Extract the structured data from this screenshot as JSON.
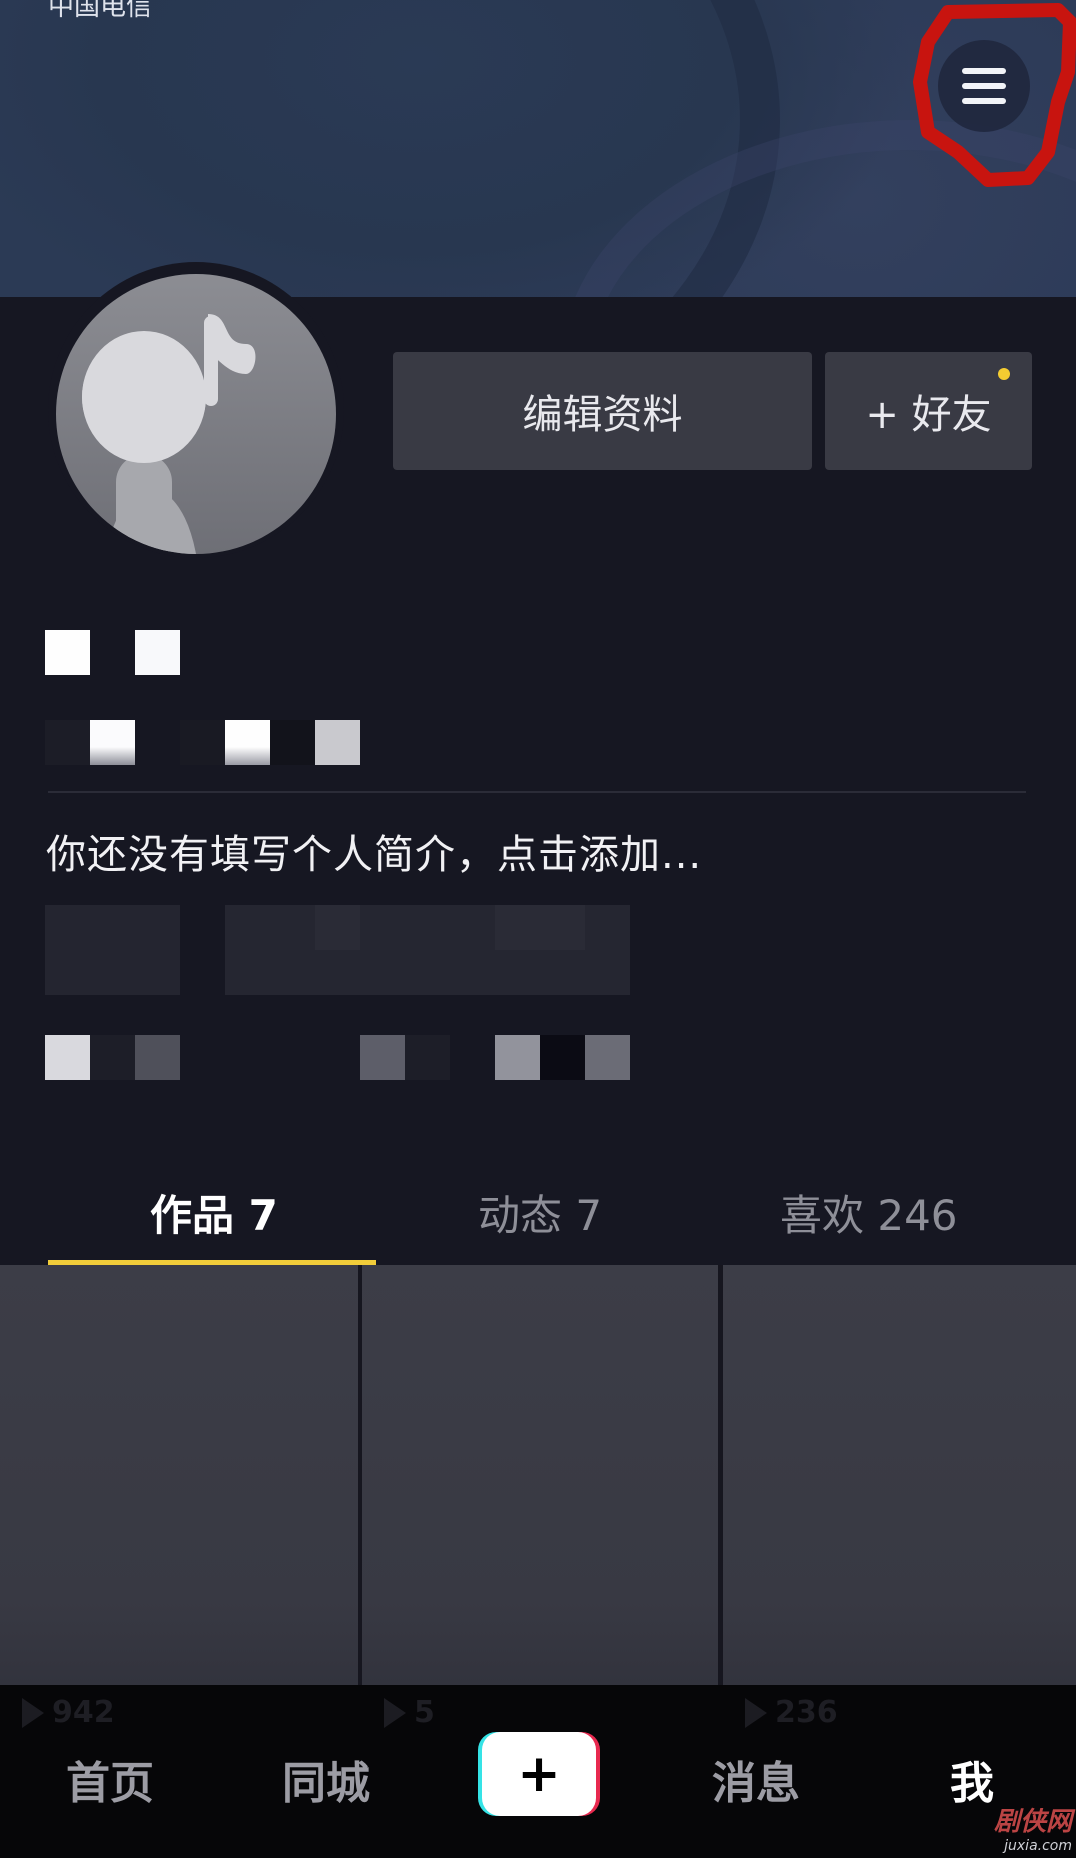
{
  "status_bar": {
    "carrier": "中国电信"
  },
  "header": {
    "menu_icon": "hamburger-menu-icon"
  },
  "profile": {
    "avatar_icon": "music-note-avatar-icon",
    "edit_profile_label": "编辑资料",
    "add_friend_label": "+ 好友",
    "bio_placeholder": "你还没有填写个人简介，点击添加..."
  },
  "tabs": [
    {
      "label": "作品 7",
      "active": true
    },
    {
      "label": "动态 7",
      "active": false
    },
    {
      "label": "喜欢 246",
      "active": false
    }
  ],
  "videos": [
    {
      "play_count": "942"
    },
    {
      "play_count": "5"
    },
    {
      "play_count": "236"
    }
  ],
  "bottom_nav": [
    {
      "label": "首页",
      "active": false
    },
    {
      "label": "同城",
      "active": false
    },
    {
      "label": "+",
      "active": false
    },
    {
      "label": "消息",
      "active": false
    },
    {
      "label": "我",
      "active": true
    }
  ],
  "watermark": {
    "brand": "剧侠网",
    "domain": "juxia.com"
  },
  "colors": {
    "accent_yellow": "#f2cd3a",
    "background": "#161722",
    "annotation_red": "#c8140f",
    "plus_cyan": "#35e3e6",
    "plus_pink": "#e8294f"
  }
}
